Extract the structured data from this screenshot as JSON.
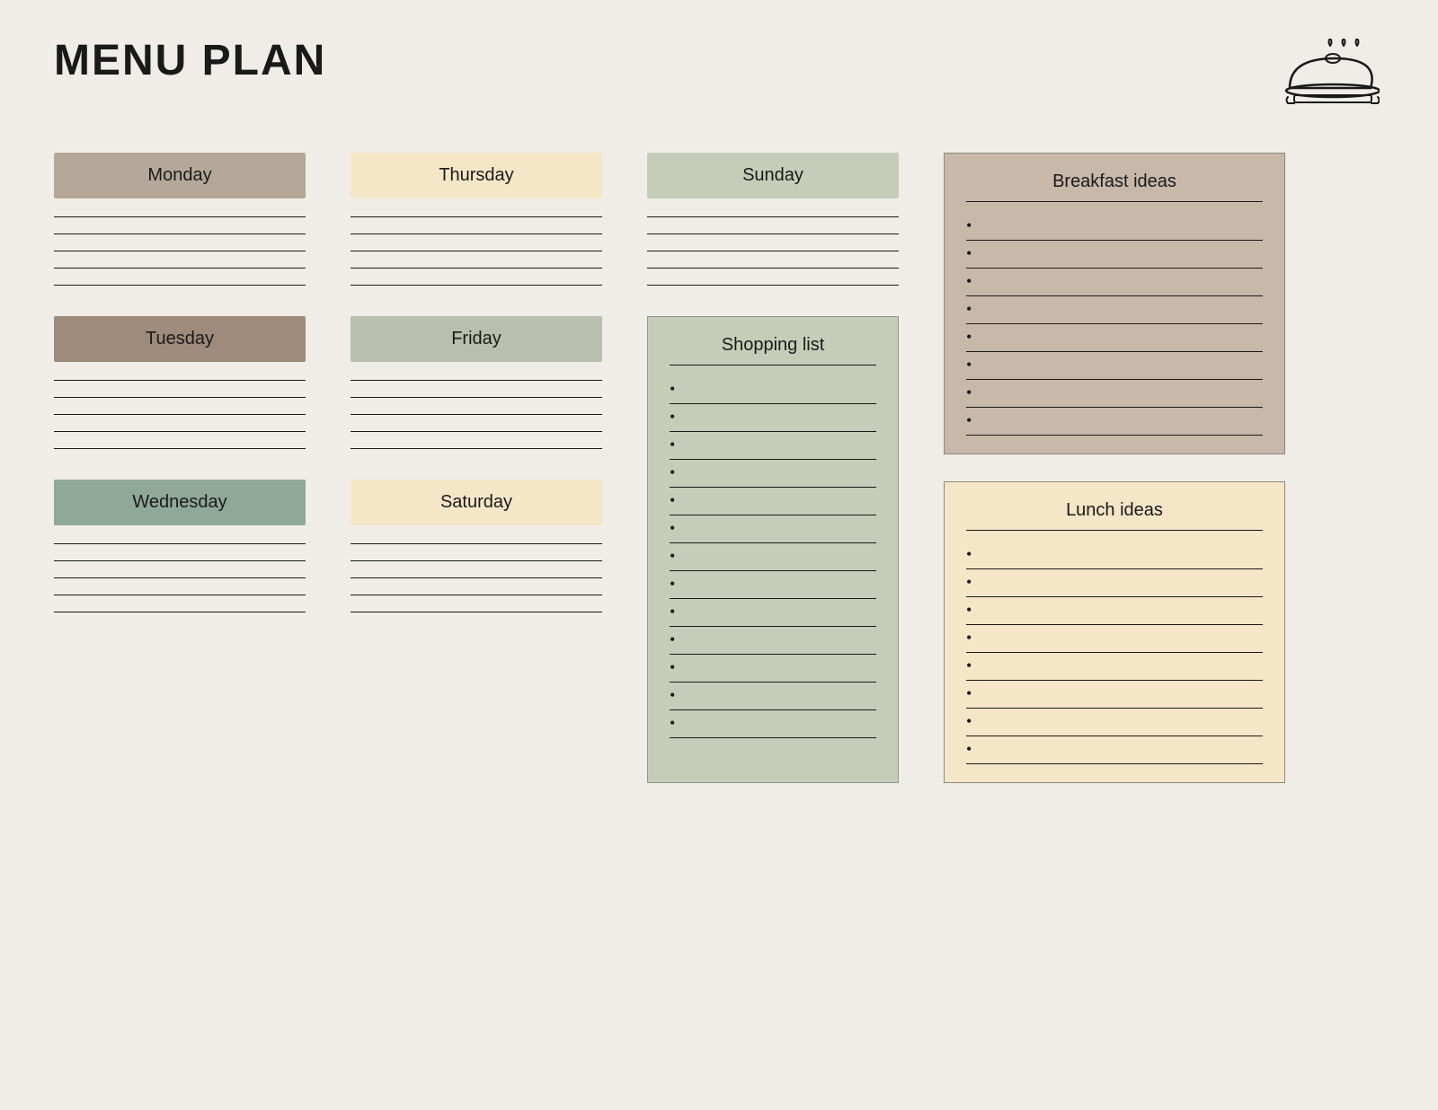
{
  "title": "MENU PLAN",
  "days": {
    "monday": {
      "label": "Monday",
      "color_class": "monday-bg",
      "lines": 5
    },
    "tuesday": {
      "label": "Tuesday",
      "color_class": "tuesday-bg",
      "lines": 5
    },
    "wednesday": {
      "label": "Wednesday",
      "color_class": "wednesday-bg",
      "lines": 5
    },
    "thursday": {
      "label": "Thursday",
      "color_class": "thursday-bg",
      "lines": 5
    },
    "friday": {
      "label": "Friday",
      "color_class": "friday-bg",
      "lines": 5
    },
    "saturday": {
      "label": "Saturday",
      "color_class": "saturday-bg",
      "lines": 5
    },
    "sunday": {
      "label": "Sunday",
      "color_class": "sunday-bg",
      "lines": 5
    }
  },
  "shopping_list": {
    "title": "Shopping list",
    "items": 13
  },
  "breakfast_ideas": {
    "title": "Breakfast ideas",
    "items": 8
  },
  "lunch_ideas": {
    "title": "Lunch ideas",
    "items": 8
  },
  "icon": "🍽️"
}
